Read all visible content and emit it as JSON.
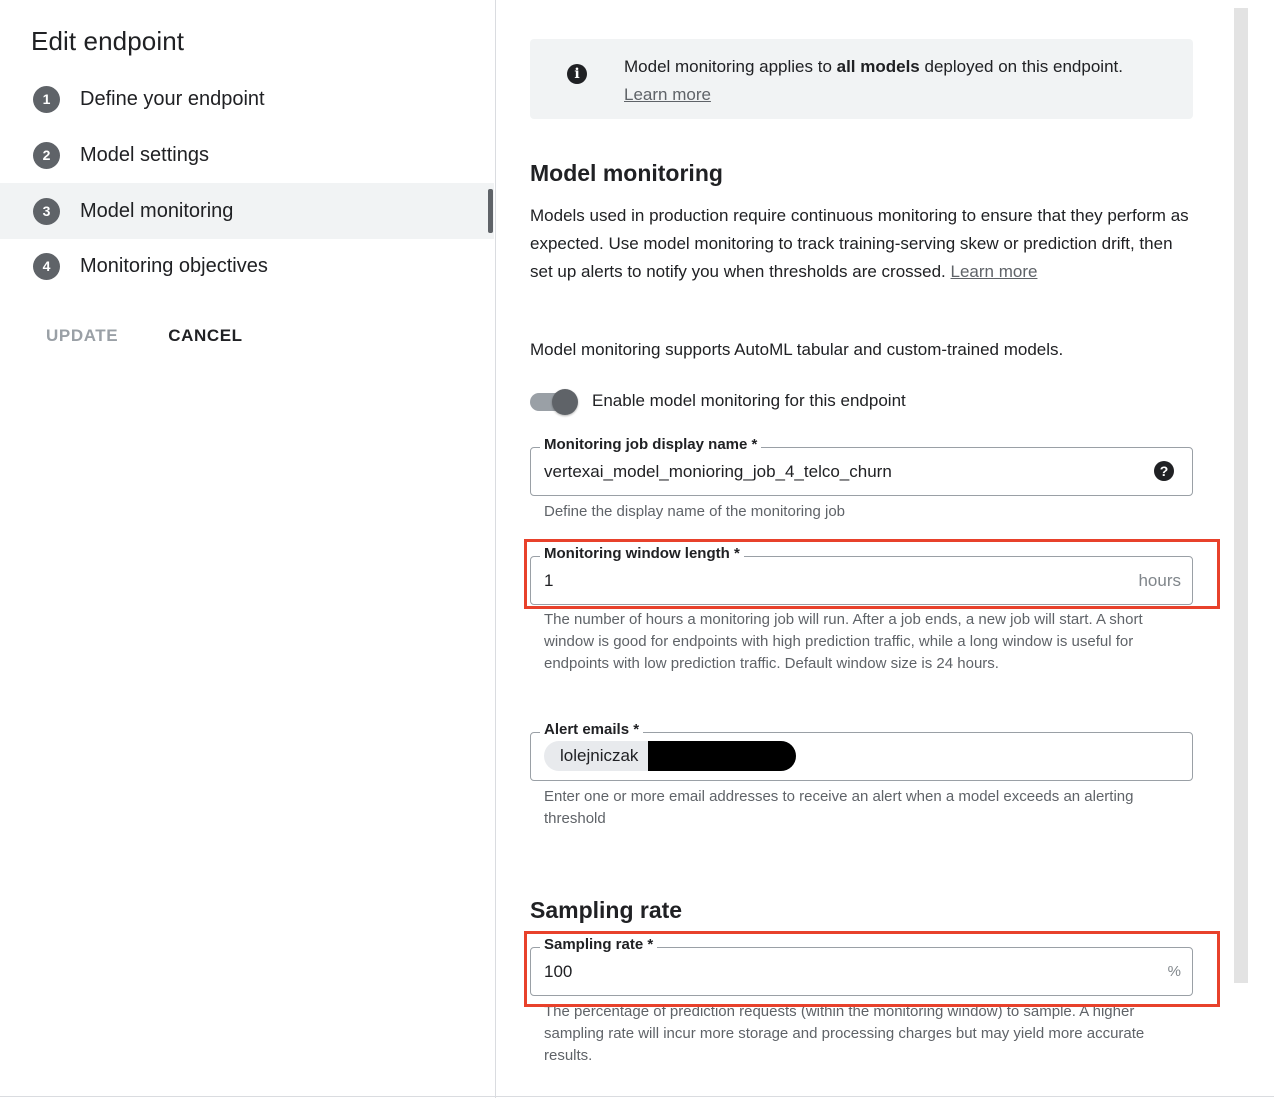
{
  "sidebar": {
    "title": "Edit endpoint",
    "steps": [
      {
        "num": "1",
        "label": "Define your endpoint"
      },
      {
        "num": "2",
        "label": "Model settings"
      },
      {
        "num": "3",
        "label": "Model monitoring"
      },
      {
        "num": "4",
        "label": "Monitoring objectives"
      }
    ],
    "active_step": "Model monitoring",
    "update_label": "UPDATE",
    "cancel_label": "CANCEL"
  },
  "info_banner": {
    "icon": "info-icon",
    "text_before": "Model monitoring applies to ",
    "text_bold": "all models",
    "text_after": " deployed on this endpoint.",
    "link": "Learn more"
  },
  "model_monitoring": {
    "heading": "Model monitoring",
    "description": "Models used in production require continuous monitoring to ensure that they perform as expected. Use model monitoring to track training-serving skew or prediction drift, then set up alerts to notify you when thresholds are crossed. ",
    "description_link": "Learn more",
    "supports_text": "Model monitoring supports AutoML tabular and custom-trained models.",
    "toggle_label": "Enable model monitoring for this endpoint",
    "toggle_on": true
  },
  "job_name_field": {
    "label": "Monitoring job display name *",
    "value": "vertexai_model_monioring_job_4_telco_churn",
    "help_icon": "help-icon",
    "hint": "Define the display name of the monitoring job"
  },
  "window_field": {
    "label": "Monitoring window length *",
    "value": "1",
    "suffix": "hours",
    "hint": "The number of hours a monitoring job will run. After a job ends, a new job will start. A short window is good for endpoints with high prediction traffic, while a long window is useful for endpoints with low prediction traffic. Default window size is 24 hours."
  },
  "alert_field": {
    "label": "Alert emails *",
    "chip_text": "lolejniczak",
    "hint": "Enter one or more email addresses to receive an alert when a model exceeds an alerting threshold"
  },
  "sampling": {
    "heading": "Sampling rate",
    "label": "Sampling rate *",
    "value": "100",
    "suffix": "%",
    "hint": "The percentage of prediction requests (within the monitoring window) to sample. A higher sampling rate will incur more storage and processing charges but may yield more accurate results."
  },
  "colors": {
    "highlight": "#e8412b",
    "accent": "#5f6368"
  }
}
